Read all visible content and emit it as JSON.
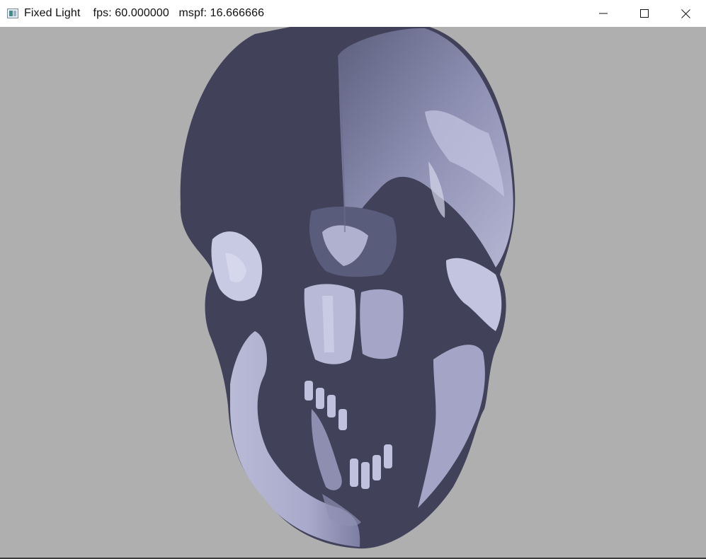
{
  "window": {
    "title": "Fixed Light    fps: 60.000000   mspf: 16.666666"
  },
  "caption_buttons": {
    "minimize_icon": "minimize-icon",
    "maximize_icon": "maximize-icon",
    "close_icon": "close-icon"
  },
  "scene": {
    "background_color": "#afafaf",
    "model": "skull",
    "shadow_color": "#41415a",
    "highlight_color": "#c7c8e2"
  }
}
